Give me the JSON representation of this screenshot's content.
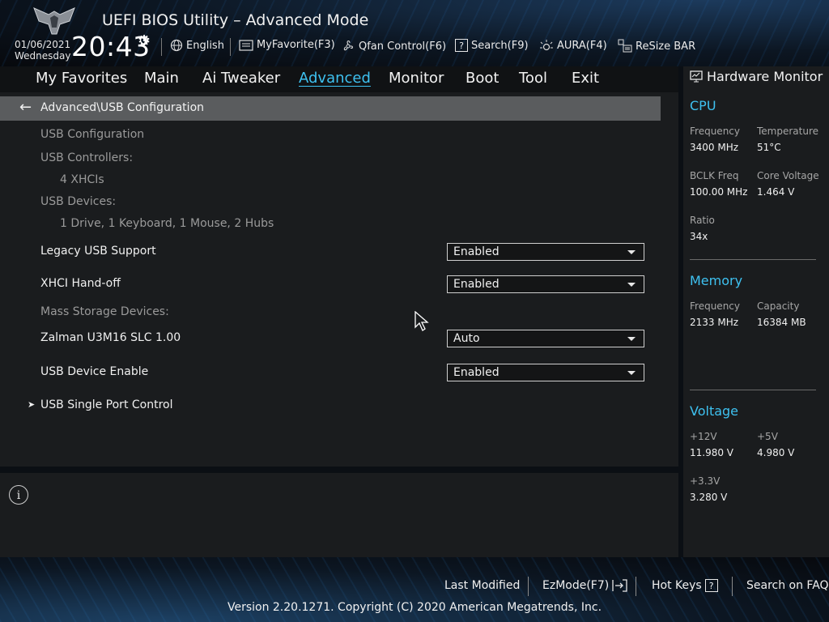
{
  "header": {
    "title": "UEFI BIOS Utility – Advanced Mode",
    "date": "01/06/2021",
    "weekday": "Wednesday",
    "time": "20:43",
    "items": [
      {
        "label": "English",
        "icon": "globe-icon"
      },
      {
        "label": "MyFavorite(F3)",
        "icon": "favorite-icon"
      },
      {
        "label": "Qfan Control(F6)",
        "icon": "fan-icon"
      },
      {
        "label": "Search(F9)",
        "icon": "search-help-icon"
      },
      {
        "label": "AURA(F4)",
        "icon": "aura-light-icon"
      },
      {
        "label": "ReSize BAR",
        "icon": "resize-bar-icon"
      }
    ]
  },
  "nav": {
    "tabs": [
      "My Favorites",
      "Main",
      "Ai Tweaker",
      "Advanced",
      "Monitor",
      "Boot",
      "Tool",
      "Exit"
    ],
    "active": "Advanced"
  },
  "breadcrumb": "Advanced\\USB Configuration",
  "content": {
    "usb_configuration": "USB Configuration",
    "usb_controllers_label": "USB Controllers:",
    "usb_controllers_value": "4 XHCIs",
    "usb_devices_label": "USB Devices:",
    "usb_devices_value": "1 Drive, 1 Keyboard, 1 Mouse, 2 Hubs",
    "mass_storage_label": "Mass Storage Devices:",
    "settings": [
      {
        "label": "Legacy USB Support",
        "value": "Enabled"
      },
      {
        "label": "XHCI Hand-off",
        "value": "Enabled"
      },
      {
        "label": "Zalman U3M16 SLC 1.00",
        "value": "Auto"
      },
      {
        "label": "USB Device Enable",
        "value": "Enabled"
      }
    ],
    "submenu": "USB Single Port Control"
  },
  "hw_monitor": {
    "title": "Hardware Monitor",
    "cpu": {
      "heading": "CPU",
      "frequency_label": "Frequency",
      "frequency": "3400 MHz",
      "temperature_label": "Temperature",
      "temperature": "51°C",
      "bclk_label": "BCLK Freq",
      "bclk": "100.00 MHz",
      "core_voltage_label": "Core Voltage",
      "core_voltage": "1.464 V",
      "ratio_label": "Ratio",
      "ratio": "34x"
    },
    "memory": {
      "heading": "Memory",
      "frequency_label": "Frequency",
      "frequency": "2133 MHz",
      "capacity_label": "Capacity",
      "capacity": "16384 MB"
    },
    "voltage": {
      "heading": "Voltage",
      "v12_label": "+12V",
      "v12": "11.980 V",
      "v5_label": "+5V",
      "v5": "4.980 V",
      "v33_label": "+3.3V",
      "v33": "3.280 V"
    }
  },
  "footer": {
    "last_modified": "Last Modified",
    "ezmode": "EzMode(F7)",
    "hot_keys": "Hot Keys",
    "hot_keys_key": "?",
    "search_faq": "Search on FAQ",
    "version": "Version 2.20.1271. Copyright (C) 2020 American Megatrends, Inc."
  },
  "colors": {
    "accent": "#3ec1f0",
    "panel": "#1a1c1e",
    "breadcrumb_bar": "#5a5c5e"
  }
}
